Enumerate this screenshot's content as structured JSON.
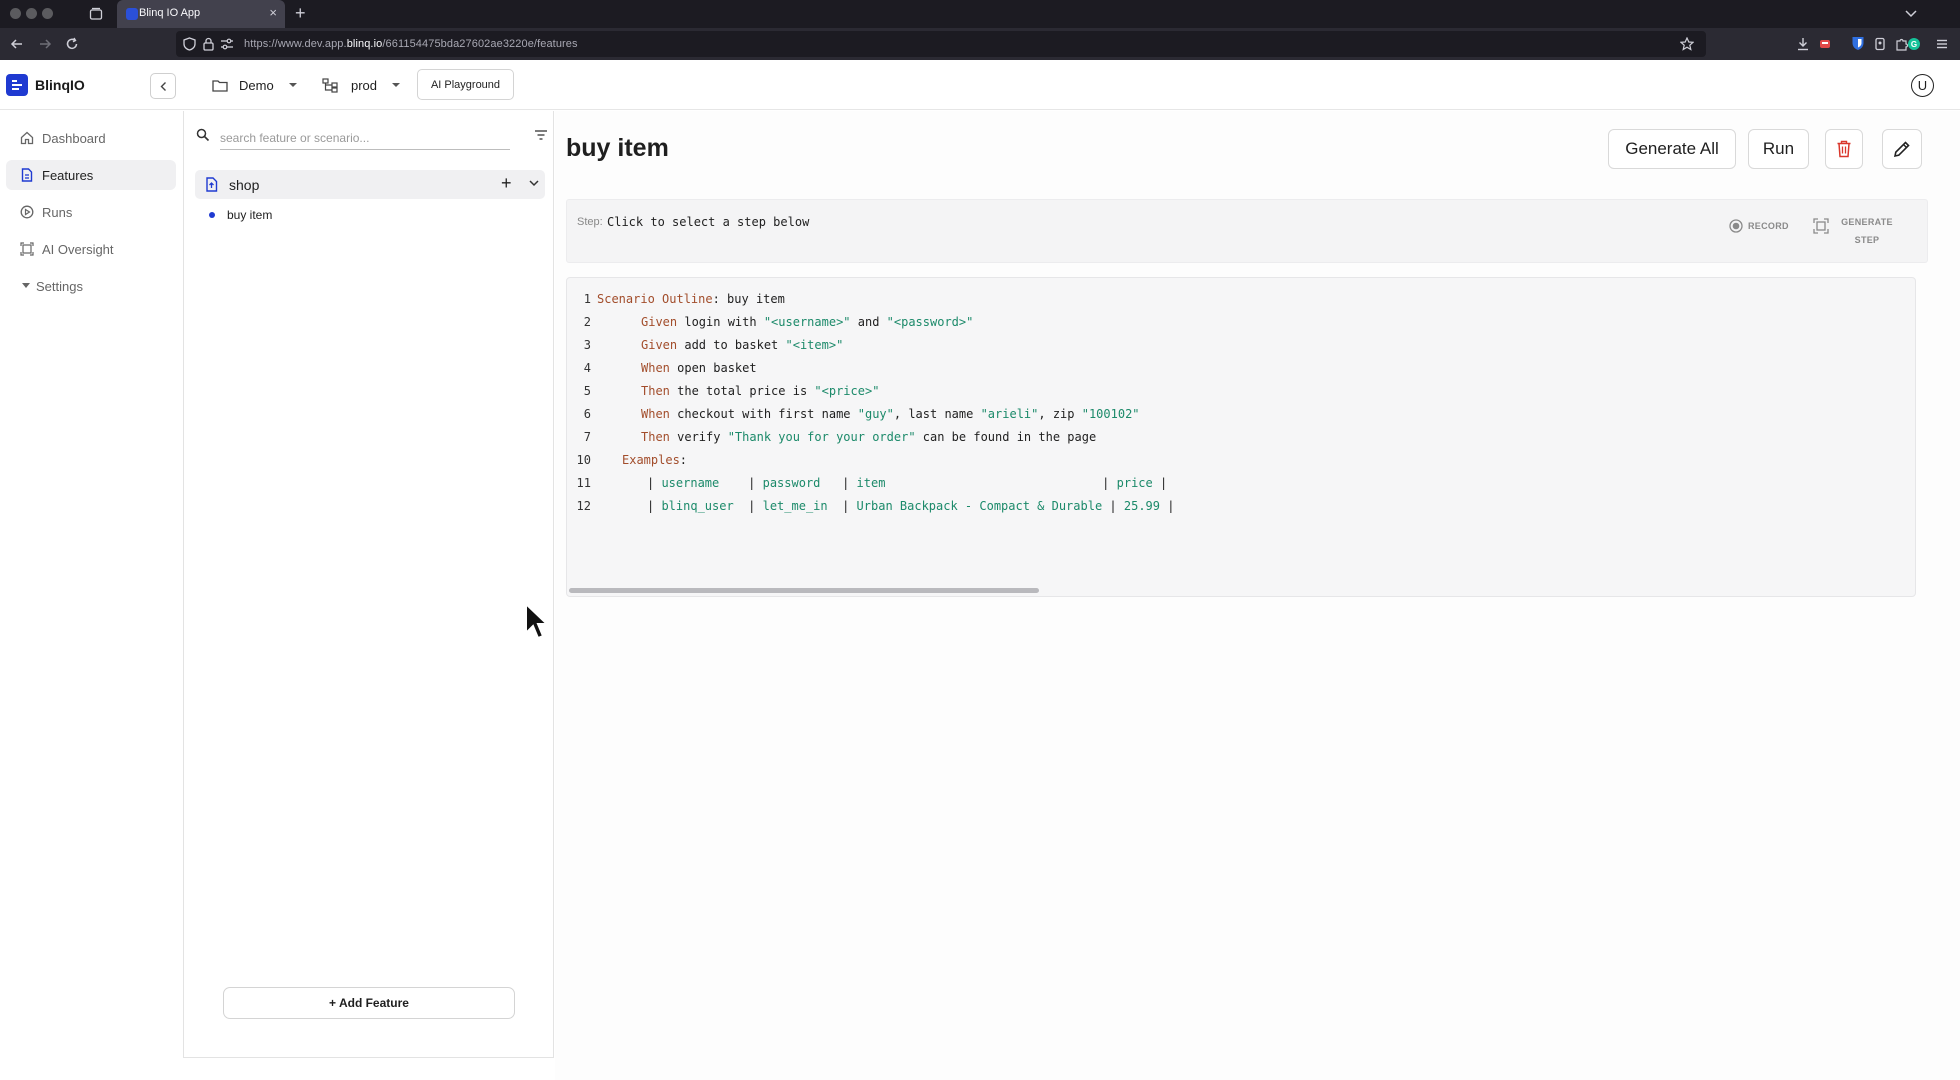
{
  "browser": {
    "tab_title": "Blinq IO App",
    "url_prefix": "https://www.dev.app.",
    "url_domain": "blinq.io",
    "url_suffix": "/661154475bda27602ae3220e/features"
  },
  "header": {
    "logo_text": "BlinqIO",
    "project": "Demo",
    "environment": "prod",
    "ai_playground": "AI Playground",
    "user_initial": "U"
  },
  "sidebar": {
    "items": [
      {
        "label": "Dashboard"
      },
      {
        "label": "Features"
      },
      {
        "label": "Runs"
      },
      {
        "label": "AI Oversight"
      },
      {
        "label": "Settings"
      }
    ]
  },
  "features_panel": {
    "search_placeholder": "search feature or scenario...",
    "feature_name": "shop",
    "scenario_name": "buy item",
    "add_feature_label": "+ Add Feature"
  },
  "main": {
    "title": "buy item",
    "generate_all_label": "Generate All",
    "run_label": "Run",
    "step_label": "Step:",
    "step_text": "Click to select a step below",
    "record_label": "RECORD",
    "generate_step_line1": "GENERATE",
    "generate_step_line2": "STEP"
  },
  "code": {
    "lines": [
      {
        "n": "1",
        "indent": 0,
        "parts": [
          [
            "kw",
            "Scenario Outline"
          ],
          [
            "tx",
            ": buy item"
          ]
        ]
      },
      {
        "n": "2",
        "indent": 3,
        "parts": [
          [
            "kw",
            "Given"
          ],
          [
            "tx",
            " login with "
          ],
          [
            "st",
            "\"<username>\""
          ],
          [
            "tx",
            " and "
          ],
          [
            "st",
            "\"<password>\""
          ]
        ]
      },
      {
        "n": "3",
        "indent": 3,
        "parts": [
          [
            "kw",
            "Given"
          ],
          [
            "tx",
            " add to basket "
          ],
          [
            "st",
            "\"<item>\""
          ]
        ]
      },
      {
        "n": "4",
        "indent": 3,
        "parts": [
          [
            "kw",
            "When"
          ],
          [
            "tx",
            " open basket"
          ]
        ]
      },
      {
        "n": "5",
        "indent": 3,
        "parts": [
          [
            "kw",
            "Then"
          ],
          [
            "tx",
            " the total price is "
          ],
          [
            "st",
            "\"<price>\""
          ]
        ]
      },
      {
        "n": "6",
        "indent": 3,
        "parts": [
          [
            "kw",
            "When"
          ],
          [
            "tx",
            " checkout with first name "
          ],
          [
            "st",
            "\"guy\""
          ],
          [
            "tx",
            ", last name "
          ],
          [
            "st",
            "\"arieli\""
          ],
          [
            "tx",
            ", zip "
          ],
          [
            "st",
            "\"100102\""
          ]
        ]
      },
      {
        "n": "7",
        "indent": 3,
        "parts": [
          [
            "kw",
            "Then"
          ],
          [
            "tx",
            " verify "
          ],
          [
            "st",
            "\"Thank you for your order\""
          ],
          [
            "tx",
            " can be found in the page"
          ]
        ]
      },
      {
        "n": "10",
        "indent": 2,
        "parts": [
          [
            "kw",
            "Examples"
          ],
          [
            "tx",
            ":"
          ]
        ]
      },
      {
        "n": "11",
        "indent": 4,
        "parts": [
          [
            "tx",
            "| "
          ],
          [
            "st",
            "username"
          ],
          [
            "tx",
            "    | "
          ],
          [
            "st",
            "password"
          ],
          [
            "tx",
            "   | "
          ],
          [
            "st",
            "item"
          ],
          [
            "tx",
            "                              | "
          ],
          [
            "st",
            "price"
          ],
          [
            "tx",
            " |"
          ]
        ]
      },
      {
        "n": "12",
        "indent": 4,
        "parts": [
          [
            "tx",
            "| "
          ],
          [
            "st",
            "blinq_user"
          ],
          [
            "tx",
            "  | "
          ],
          [
            "st",
            "let_me_in"
          ],
          [
            "tx",
            "  | "
          ],
          [
            "st",
            "Urban Backpack - Compact & Durable"
          ],
          [
            "tx",
            " | "
          ],
          [
            "st",
            "25.99"
          ],
          [
            "tx",
            " |"
          ]
        ]
      }
    ]
  },
  "colors": {
    "brand": "#1f3ad1",
    "keyword": "#a24d2b",
    "string": "#1c8a6a",
    "delete": "#d9362b"
  }
}
